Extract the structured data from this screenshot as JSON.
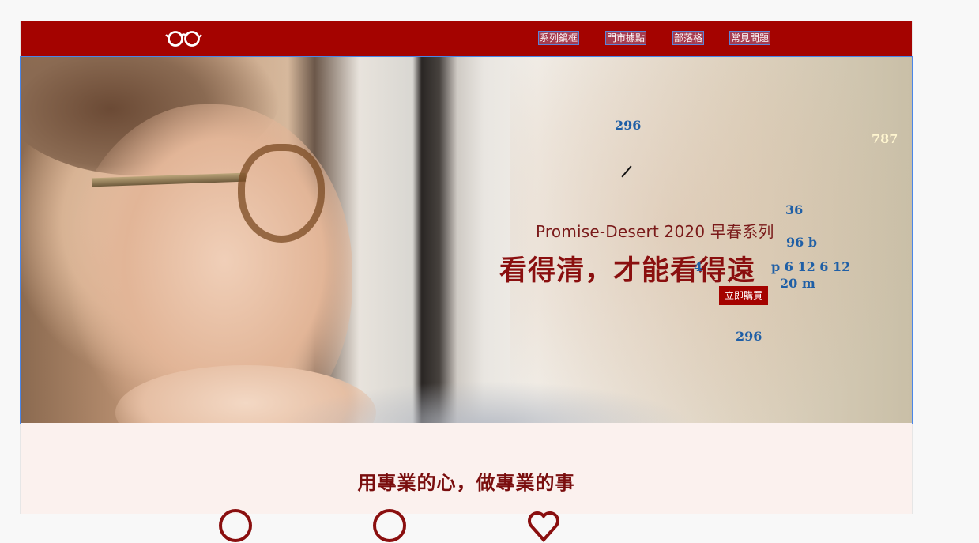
{
  "header": {
    "nav": [
      "系列鏡框",
      "門市據點",
      "部落格",
      "常見問題"
    ],
    "logo_icon": "glasses-logo-icon",
    "bg_color": "#a40300"
  },
  "hero": {
    "subtitle": "Promise-Desert 2020 早春系列",
    "title": "看得清，才能看得遠",
    "buy_button": "立即購買"
  },
  "debug_labels": {
    "top_margin": "296",
    "width": "787",
    "subtitle_size": "36",
    "title_size": "96 b",
    "padding": "p 6 12 6 12",
    "button_left": "4",
    "button_margin": "20 m",
    "bottom_margin": "296"
  },
  "section": {
    "title": "用專業的心，做專業的事",
    "icons": [
      "circle-icon",
      "circle-icon",
      "heart-icon"
    ]
  },
  "colors": {
    "brand": "#a40300",
    "section_bg": "#fbf1ee",
    "heading": "#7a0e0e"
  }
}
